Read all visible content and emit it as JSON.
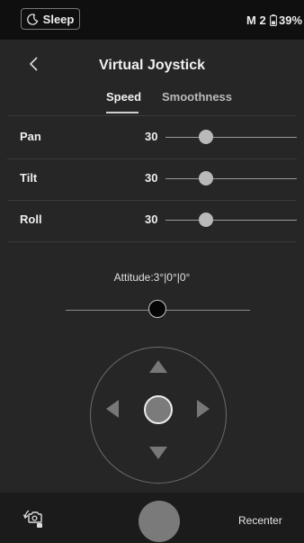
{
  "status_bar": {
    "sleep_label": "Sleep",
    "mode_label": "M 2",
    "battery": "39%"
  },
  "header": {
    "title": "Virtual Joystick"
  },
  "tabs": {
    "speed_label": "Speed",
    "smoothness_label": "Smoothness",
    "selected": "Speed"
  },
  "rows": [
    {
      "label": "Pan",
      "value": "30"
    },
    {
      "label": "Tilt",
      "value": "30"
    },
    {
      "label": "Roll",
      "value": "30"
    }
  ],
  "attitude": {
    "label": "Attitude:3°|0°|0°"
  },
  "bottom_bar": {
    "recenter_label": "Recenter"
  },
  "icons": {
    "sleep": "moon-icon",
    "battery": "battery-icon",
    "back": "chevron-left-icon",
    "camera_switch": "camera-rotate-icon",
    "shutter": "shutter-button"
  },
  "colors": {
    "background": "#262626",
    "status_bar": "#0f0f0f",
    "bottom_bar": "#1b1b1b",
    "slider_knob": "#b9b9b9"
  }
}
